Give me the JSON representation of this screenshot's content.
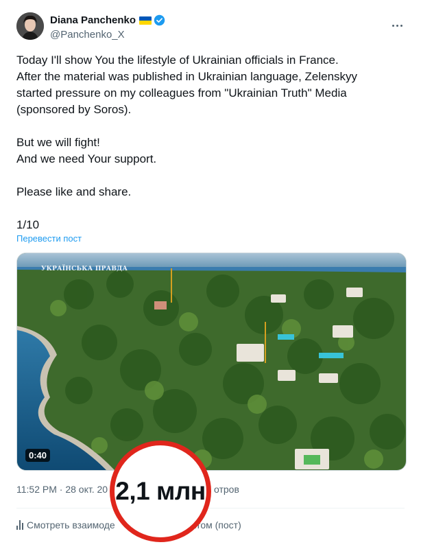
{
  "author": {
    "name": "Diana Panchenko",
    "handle": "@Panchenko_X"
  },
  "tweet": {
    "lines": [
      "Today I'll show You the lifestyle of Ukrainian officials in France.",
      "After the material was published in Ukrainian language, Zelenskyy",
      "started pressure on my colleagues from \"Ukrainian Truth\" Media",
      "(sponsored by Soros).",
      "But we will fight!",
      "And we need Your support.",
      "Please like and share.",
      "1/10"
    ],
    "translate_label": "Перевести пост"
  },
  "video": {
    "watermark": "УКРАЇНСЬКА ПРАВДА",
    "duration": "0:40"
  },
  "meta": {
    "time_date": "11:52 PM · 28 окт. 20",
    "views_suffix": "отров"
  },
  "overlay": {
    "views_count": "2,1 млн"
  },
  "engagement": {
    "label_left": "Смотреть взаимоде",
    "label_right": "ектом (пост)"
  },
  "colors": {
    "accent": "#1d9bf0",
    "highlight_ring": "#e0261c",
    "secondary_text": "#536471"
  }
}
